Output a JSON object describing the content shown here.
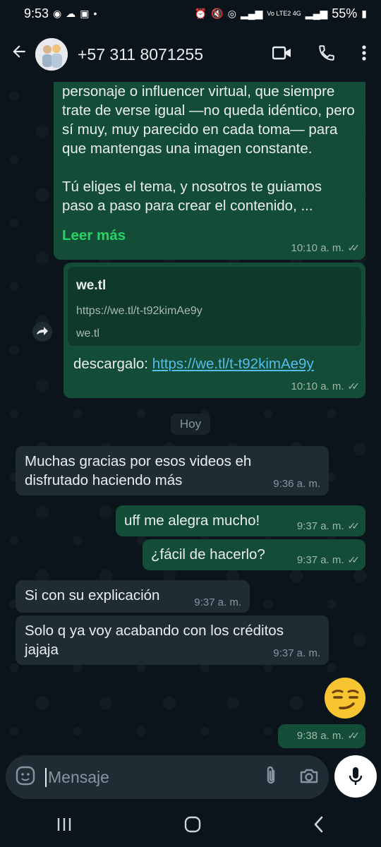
{
  "status_bar": {
    "time": "9:53",
    "network": "Vo LTE2 4G",
    "battery": "55%"
  },
  "header": {
    "contact_name": "+57 311 8071255"
  },
  "messages": [
    {
      "type": "outgoing",
      "text": "personaje o influencer virtual, que siempre trate de verse igual —no queda idéntico, pero sí muy, muy parecido en cada toma— para que mantengas una imagen constante.\n\nTú eliges el tema, y nosotros te guiamos paso a paso para crear el contenido, ...",
      "more_label": "Leer más",
      "time": "10:10 a. m."
    },
    {
      "type": "outgoing",
      "link_title": "we.tl",
      "link_url": "https://we.tl/t-t92kimAe9y",
      "link_domain": "we.tl",
      "text_prefix": "descargalo:",
      "text_link": "https://we.tl/t-t92kimAe9y",
      "time": "10:10 a. m."
    },
    {
      "type": "incoming",
      "text": "Muchas gracias por esos videos eh disfrutado haciendo más",
      "time": "9:36 a. m."
    },
    {
      "type": "outgoing",
      "text": "uff me alegra mucho!",
      "time": "9:37 a. m."
    },
    {
      "type": "outgoing",
      "text": "¿fácil de hacerlo?",
      "time": "9:37 a. m."
    },
    {
      "type": "incoming",
      "text": "Si con su explicación",
      "time": "9:37 a. m."
    },
    {
      "type": "incoming",
      "text": "Solo q ya voy acabando con los créditos jajaja",
      "time": "9:37 a. m."
    },
    {
      "type": "outgoing",
      "text": "😏",
      "time": "9:38 a. m."
    }
  ],
  "day_separator": "Hoy",
  "input": {
    "placeholder": "Mensaje"
  },
  "colors": {
    "outgoing_bubble": "#144d37",
    "incoming_bubble": "#202c33",
    "accent": "#25d366",
    "link": "#53bdeb"
  }
}
